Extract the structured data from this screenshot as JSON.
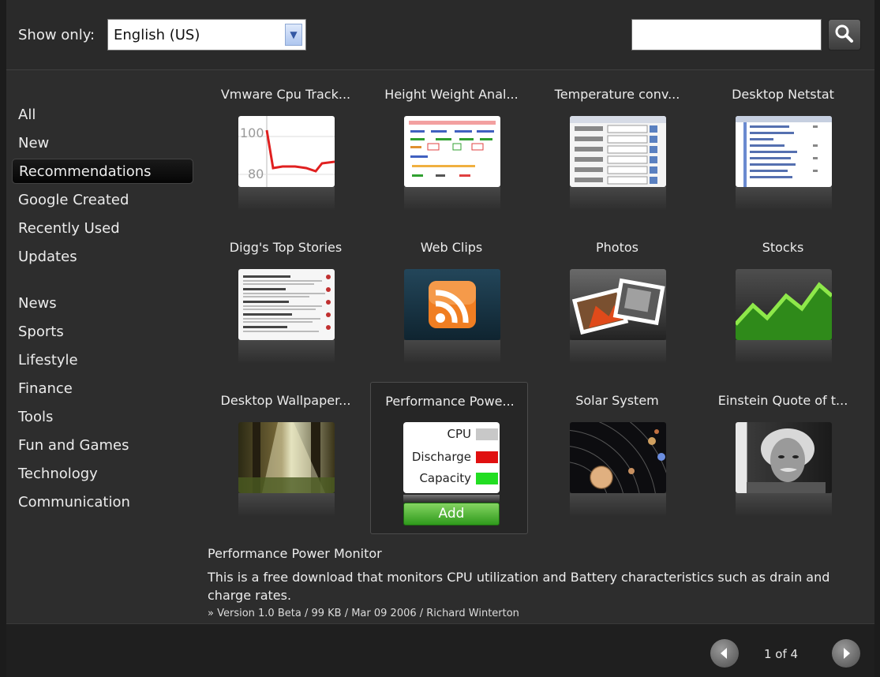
{
  "filter": {
    "label": "Show only:",
    "language": "English (US)"
  },
  "search": {
    "placeholder": ""
  },
  "categories": [
    "All",
    "New",
    "Recommendations",
    "Google Created",
    "Recently Used",
    "Updates",
    "News",
    "Sports",
    "Lifestyle",
    "Finance",
    "Tools",
    "Fun and Games",
    "Technology",
    "Communication"
  ],
  "selected_category": "Recommendations",
  "gadgets": [
    {
      "title": "Vmware Cpu Track..."
    },
    {
      "title": "Height Weight Anal..."
    },
    {
      "title": "Temperature conv..."
    },
    {
      "title": "Desktop Netstat"
    },
    {
      "title": "Digg's Top Stories"
    },
    {
      "title": "Web Clips"
    },
    {
      "title": "Photos"
    },
    {
      "title": "Stocks"
    },
    {
      "title": "Desktop Wallpaper..."
    },
    {
      "title": "Performance Powe..."
    },
    {
      "title": "Solar System"
    },
    {
      "title": "Einstein Quote of t..."
    }
  ],
  "thumb_text": {
    "vmware_ticks": [
      "100",
      "80"
    ],
    "performance_rows": [
      "CPU",
      "Discharge",
      "Capacity"
    ]
  },
  "add_button": "Add",
  "details": {
    "title": "Performance Power Monitor",
    "description": "This is a free download that monitors CPU utilization and Battery characteristics such as drain and charge rates.",
    "meta": "» Version 1.0 Beta / 99 KB / Mar 09 2006 / Richard Winterton"
  },
  "pagination": {
    "label": "1 of 4"
  },
  "colors": {
    "selected_bg": "#0a0a0a",
    "add_green": "#3fa82a",
    "discharge_red": "#e01010",
    "capacity_green": "#22dd22"
  }
}
